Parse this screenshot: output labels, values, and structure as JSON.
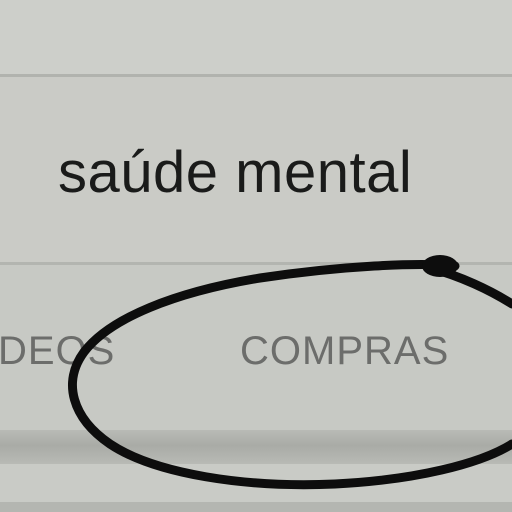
{
  "search": {
    "query": "saúde mental"
  },
  "tabs": [
    {
      "label": "DEOS"
    },
    {
      "label": "COMPRAS"
    }
  ],
  "annotation": {
    "type": "hand-drawn-circle",
    "color": "#0d0d0d",
    "target": "COMPRAS"
  }
}
